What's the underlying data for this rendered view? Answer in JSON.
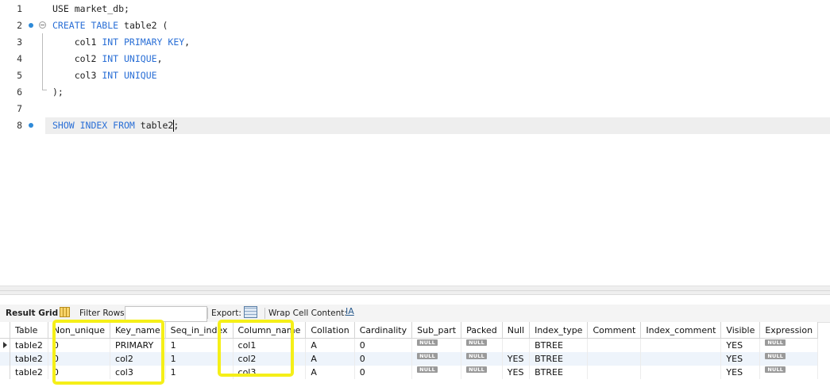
{
  "editor": {
    "line_numbers": [
      "1",
      "2",
      "3",
      "4",
      "5",
      "6",
      "7",
      "8"
    ],
    "lines": [
      [
        {
          "t": "USE market_db;",
          "k": false
        }
      ],
      [
        {
          "t": "CREATE TABLE",
          "k": true
        },
        {
          "t": " table2 (",
          "k": false
        }
      ],
      [
        {
          "t": "    col1 ",
          "k": false
        },
        {
          "t": "INT PRIMARY KEY",
          "k": true
        },
        {
          "t": ",",
          "k": false
        }
      ],
      [
        {
          "t": "    col2 ",
          "k": false
        },
        {
          "t": "INT UNIQUE",
          "k": true
        },
        {
          "t": ",",
          "k": false
        }
      ],
      [
        {
          "t": "    col3 ",
          "k": false
        },
        {
          "t": "INT UNIQUE",
          "k": true
        }
      ],
      [
        {
          "t": ");",
          "k": false
        }
      ],
      [],
      [
        {
          "t": "SHOW INDEX FROM",
          "k": true
        },
        {
          "t": " table2",
          "k": false
        },
        {
          "caret": true
        },
        {
          "t": ";",
          "k": false
        }
      ]
    ],
    "statement_markers": [
      2,
      8
    ]
  },
  "toolbar": {
    "result_grid_label": "Result Grid",
    "filter_rows_label": "Filter Rows:",
    "filter_value": "",
    "export_label": "Export:",
    "wrap_label": "Wrap Cell Content:",
    "wrap_icon_glyph": "I̲A",
    "grid_icon": "grid-icon",
    "export_icon": "export-icon"
  },
  "results": {
    "columns": [
      "Table",
      "Non_unique",
      "Key_name",
      "Seq_in_index",
      "Column_name",
      "Collation",
      "Cardinality",
      "Sub_part",
      "Packed",
      "Null",
      "Index_type",
      "Comment",
      "Index_comment",
      "Visible",
      "Expression"
    ],
    "null_label": "NULL",
    "rows": [
      [
        "table2",
        "0",
        "PRIMARY",
        "1",
        "col1",
        "A",
        "0",
        null,
        null,
        "",
        "BTREE",
        "",
        "",
        "YES",
        null
      ],
      [
        "table2",
        "0",
        "col2",
        "1",
        "col2",
        "A",
        "0",
        null,
        null,
        "YES",
        "BTREE",
        "",
        "",
        "YES",
        null
      ],
      [
        "table2",
        "0",
        "col3",
        "1",
        "col3",
        "A",
        "0",
        null,
        null,
        "YES",
        "BTREE",
        "",
        "",
        "YES",
        null
      ]
    ],
    "current_row": 0
  },
  "colors": {
    "keyword": "#2a6fd6",
    "highlight": "#f5ef18",
    "alt_row": "#eef4fb",
    "marker_dot": "#2e8ad8"
  }
}
